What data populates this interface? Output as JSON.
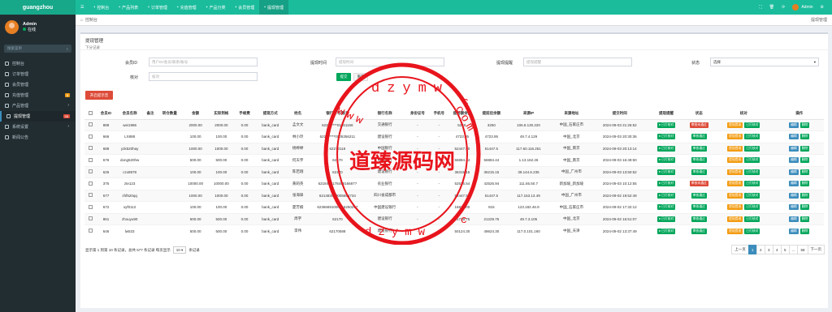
{
  "brand": "guangzhou",
  "nav": [
    {
      "label": "控制台",
      "active": false
    },
    {
      "label": "产品列表",
      "active": false
    },
    {
      "label": "订单管理",
      "active": false
    },
    {
      "label": "充值管理",
      "active": false
    },
    {
      "label": "产品分类",
      "active": false
    },
    {
      "label": "会员管理",
      "active": false
    },
    {
      "label": "提现管理",
      "active": true
    }
  ],
  "topright": {
    "user": "Admin"
  },
  "sidebar": {
    "user": "Admin",
    "status": "在线",
    "search_placeholder": "搜索菜单",
    "items": [
      {
        "label": "控制台",
        "badge": "",
        "active": false
      },
      {
        "label": "订单管理",
        "badge": "",
        "active": false
      },
      {
        "label": "会员管理",
        "badge": "",
        "active": false
      },
      {
        "label": "充值管理",
        "badge": "8",
        "active": false
      },
      {
        "label": "产品管理",
        "badge": "",
        "active": false,
        "chev": true
      },
      {
        "label": "提现管理",
        "badge": "36",
        "active": true
      },
      {
        "label": "系统设置",
        "badge": "",
        "active": false,
        "chev": true
      },
      {
        "label": "新闻公告",
        "badge": "",
        "active": false
      }
    ]
  },
  "tabbar": {
    "tab": "控制台",
    "right": "提现管理"
  },
  "header": {
    "title": "提现管理",
    "subtitle": "下分记录"
  },
  "filters": {
    "member_id_label": "会员ID",
    "member_id_placeholder": "用户ID/会员/联系/账号",
    "time_label": "提现时间",
    "time_placeholder": "提现时间",
    "remind_label": "提现提醒",
    "remind_placeholder": "提现提醒",
    "status_label": "状态",
    "status_value": "选择",
    "check_label": "核对",
    "check_placeholder": "核对",
    "submit": "提交",
    "reset": "重置",
    "open_btn": "开启提示音"
  },
  "table": {
    "headers": [
      "",
      "会员ID",
      "会员名称",
      "备注",
      "转仓数量",
      "金额",
      "实际到帐",
      "手续费",
      "提现方式",
      "姓名",
      "银行卡号/账号",
      "银行名称",
      "身份证号",
      "手机号",
      "提前额余额",
      "提前后余额",
      "来源IP",
      "来源地址",
      "提交时间",
      "提现提醒",
      "状态",
      "核对",
      "操作"
    ],
    "rows": [
      [
        "889",
        "wei1986",
        "",
        "",
        "2000.00",
        "2000.00",
        "0.00",
        "bank_card",
        "孟文文",
        "6228*****01861166",
        "交通银行",
        "-",
        "-",
        "5250.",
        "3250",
        "106.8.130.220",
        "中国_石家庄市",
        "2024-09-03 21:26:52",
        "r"
      ],
      [
        "666",
        "LX888",
        "",
        "",
        "100.00",
        "100.00",
        "0.00",
        "bank_card",
        "林小玲",
        "6217*****0005356211",
        "建设银行",
        "-",
        "-",
        "4723.95",
        "4723.95",
        "49.7.4.129",
        "中国_北京",
        "2024-09-03 20:30:36",
        "g"
      ],
      [
        "688",
        "yzk520hay",
        "",
        "",
        "1000.00",
        "1000.00",
        "0.00",
        "bank_card",
        "杨婷婷",
        "62270118",
        "中国银行",
        "-",
        "-",
        "52447.50",
        "51447.5",
        "117.60.116.251",
        "中国_南京",
        "2024-09-03 20:13:14",
        "g"
      ],
      [
        "676",
        "dong520hw",
        "",
        "",
        "500.00",
        "500.00",
        "0.00",
        "bank_card",
        "何天宇",
        "62170",
        "中国银行",
        "-",
        "-",
        "56884.44",
        "56884.44",
        "1.13.162.26",
        "中国_南京",
        "2024-09-03 16:49:50",
        "g"
      ],
      [
        "626",
        "czx8978",
        "",
        "",
        "100.00",
        "100.00",
        "0.00",
        "bank_card",
        "陈若翔",
        "62170",
        "建设银行",
        "-",
        "-",
        "36315.15",
        "36215.15",
        "39.144.6.235",
        "中国_广州市",
        "2024-09-03 13:50:52",
        "g"
      ],
      [
        "375",
        "zte123",
        "",
        "",
        "10000.00",
        "10000.00",
        "0.00",
        "bank_card",
        "黄莉英",
        "621840017845816687?",
        "农业银行",
        "-",
        "-",
        "52526.54",
        "42526.94",
        "111.65.50.7",
        "新加坡_新加坡",
        "2024-09-03 10:12:55",
        "r"
      ],
      [
        "677",
        "zhf520qq",
        "",
        "",
        "1000.00",
        "1000.00",
        "0.00",
        "bank_card",
        "张海锋",
        "621483000005654734",
        "四川省成都市",
        "-",
        "-",
        "52447.50",
        "51447.5",
        "117.153.13.49",
        "中国_广州市",
        "2024-09-02 19:52:49",
        "g"
      ],
      [
        "672",
        "xyf0112",
        "",
        "",
        "100.00",
        "100.00",
        "0.00",
        "bank_card",
        "夏芳楠",
        "62366691000016250297",
        "中国建设银行",
        "-",
        "-",
        "16815.00",
        "815",
        "123.182.46.9",
        "中国_石家庄市",
        "2024-09-02 17:32:12",
        "g"
      ],
      [
        "861",
        "zhouyu90",
        "",
        "",
        "500.00",
        "500.00",
        "0.00",
        "bank_card",
        "周宇",
        "62170",
        "建设银行",
        "-",
        "-",
        "21729.75",
        "21229.75",
        "49.7.3.105",
        "中国_北京",
        "2024-09-02 16:51:07",
        "g"
      ],
      [
        "646",
        "lw533",
        "",
        "",
        "500.00",
        "500.00",
        "0.00",
        "bank_card",
        "李伟",
        "62170588",
        "建设银行",
        "-",
        "-",
        "50124.30",
        "49624.30",
        "117.0.101.160",
        "中国_天津",
        "2024-09-02 13:37:49",
        "g"
      ]
    ]
  },
  "tags": {
    "status_red": "审核未通过",
    "status_green": "审核通过",
    "check1": "提现提现",
    "check2": "已打核对",
    "op1": "编辑",
    "op2": "删除"
  },
  "footer": {
    "summary": "显示第 1 到第 10 条记录，总共 577 条记录 每页显示",
    "per_page": "10",
    "suffix": "条记录"
  },
  "pager": [
    "上一页",
    "1",
    "2",
    "3",
    "4",
    "5",
    "...",
    "58",
    "下一页"
  ],
  "watermark": {
    "top": "dzymw",
    "left": "www",
    "right": "com",
    "main": "道臻源码网",
    "bottom": "dzymw",
    "c1": "c",
    "c2": "c"
  },
  "colors": {
    "topbar": "#1abc9c",
    "sidebar": "#222d32",
    "watermark": "#e8141c"
  }
}
